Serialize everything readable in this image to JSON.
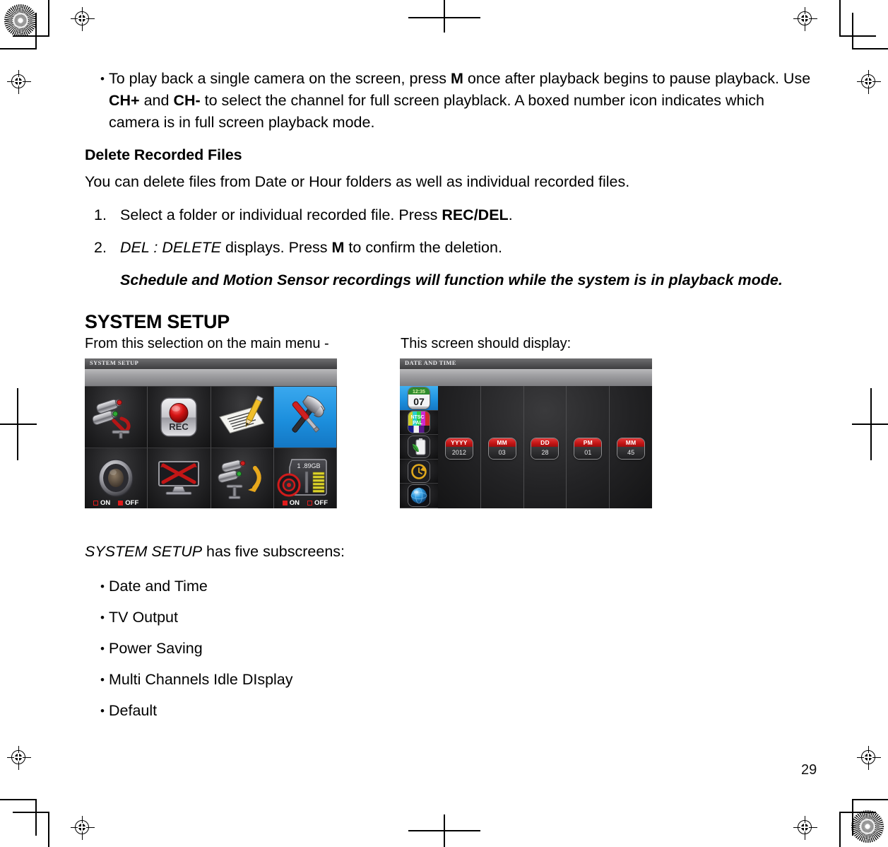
{
  "page": {
    "number": "29"
  },
  "intro_bullet": {
    "marker": "•",
    "seg1": "To play back a single camera on the screen, press ",
    "kbd1": "M",
    "seg2": " once after playback begins to pause playback. Use ",
    "kbd2": "CH+",
    "seg3": " and ",
    "kbd3": "CH-",
    "seg4": " to select the channel for full screen playblack. A boxed number icon indicates which camera is in full screen playback mode."
  },
  "delete_section": {
    "heading": "Delete Recorded Files",
    "paragraph": "You can delete files from Date or Hour folders as well as individual recorded files.",
    "steps": [
      {
        "marker": "1.",
        "seg1": "Select a folder or individual recorded file. Press ",
        "kbd": "REC/DEL",
        "seg2": "."
      },
      {
        "marker": "2.",
        "italic": "DEL : DELETE",
        "seg1": " displays. Press ",
        "kbd": "M",
        "seg2": " to confirm the deletion."
      }
    ],
    "note": "Schedule and Motion Sensor recordings will function while the system is in playback mode."
  },
  "system_setup": {
    "heading": "SYSTEM SETUP",
    "caption_left": "From this selection on the main menu -",
    "caption_right": "This screen should display:",
    "subscreens_lead_italic": "SYSTEM SETUP",
    "subscreens_lead_rest": " has five subscreens:",
    "subscreens": [
      {
        "marker": "•",
        "label": "Date and Time"
      },
      {
        "marker": "•",
        "label": "TV Output"
      },
      {
        "marker": "•",
        "label": "Power Saving"
      },
      {
        "marker": "•",
        "label": "Multi Channels Idle DIsplay"
      },
      {
        "marker": "•",
        "label": "Default"
      }
    ]
  },
  "main_menu_screenshot": {
    "title": "SYSTEM SETUP",
    "cells": [
      {
        "name": "camera-setup-icon",
        "label": ""
      },
      {
        "name": "record-setup-icon",
        "label": "REC"
      },
      {
        "name": "schedule-setup-icon",
        "label": ""
      },
      {
        "name": "system-setup-icon",
        "label": "",
        "selected": true
      },
      {
        "name": "audio-setup-icon",
        "label": ""
      },
      {
        "name": "display-off-icon",
        "label": ""
      },
      {
        "name": "channel-rotate-icon",
        "label": ""
      },
      {
        "name": "storage-icon",
        "label": "1 .89GB"
      }
    ],
    "audio_toggle": {
      "on_label": "ON",
      "off_label": "OFF",
      "selected": "OFF"
    },
    "storage_toggle": {
      "on_label": "ON",
      "off_label": "OFF",
      "selected": "ON"
    }
  },
  "date_time_screenshot": {
    "title": "DATE AND TIME",
    "sidebar": [
      {
        "name": "sidebar-icon-date-and-time",
        "badge": "07",
        "badge_top": "12:35",
        "selected": true
      },
      {
        "name": "sidebar-icon-tv-output",
        "badge": "NTSC",
        "badge_top": "PAL"
      },
      {
        "name": "sidebar-icon-power-saving",
        "badge": ""
      },
      {
        "name": "sidebar-icon-idle-display",
        "badge": ""
      },
      {
        "name": "sidebar-icon-default",
        "badge": ""
      }
    ],
    "fields": [
      {
        "name": "year-field",
        "header": "YYYY",
        "value": "2012"
      },
      {
        "name": "month-field",
        "header": "MM",
        "value": "03"
      },
      {
        "name": "day-field",
        "header": "DD",
        "value": "28"
      },
      {
        "name": "hour-field",
        "header": "PM",
        "value": "01"
      },
      {
        "name": "minute-field",
        "header": "MM",
        "value": "45"
      }
    ]
  },
  "colors": {
    "accent_blue": "#1c8fdd",
    "accent_red": "#c21414",
    "paper": "#ffffff",
    "ink": "#000000"
  }
}
